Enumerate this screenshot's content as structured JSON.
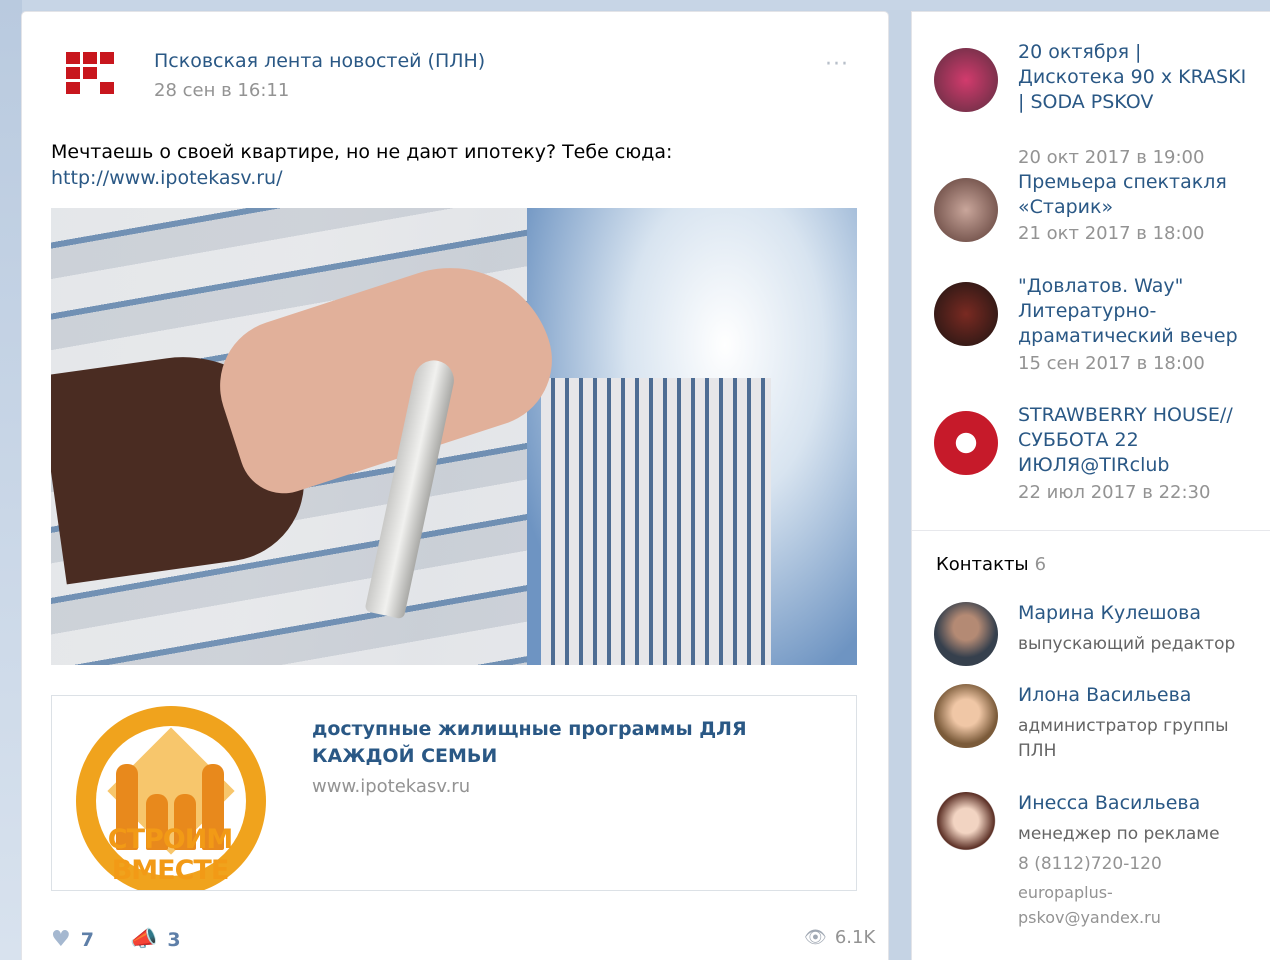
{
  "post": {
    "author": "Псковская лента новостей (ПЛН)",
    "date": "28 сен в 16:11",
    "menu": "···",
    "text": "Мечтаешь о своей квартире, но не дают ипотеку? Тебе сюда:",
    "link": "http://www.ipotekasv.ru/",
    "snippet": {
      "logo_text": "СТРОИМ ВМЕСТЕ",
      "title": "доступные жилищные программы ДЛЯ КАЖДОЙ СЕМЬИ",
      "domain": "www.ipotekasv.ru"
    },
    "likes": "7",
    "shares": "3",
    "views": "6.1K"
  },
  "sidebar": {
    "events": [
      {
        "title": "20 октября | Дискотека 90 х KRASKI | SODA PSKOV",
        "date": "20 окт 2017 в 19:00"
      },
      {
        "title": "Премьера спектакля «Старик»",
        "date": "21 окт 2017 в 18:00"
      },
      {
        "title": "\"Довлатов. Way\" Литературно-драматический вечер",
        "date": "15 сен 2017 в 18:00"
      },
      {
        "title": "STRAWBERRY HOUSE//СУББОТА 22 ИЮЛЯ@TIRclub",
        "date": "22 июл 2017 в 22:30"
      }
    ],
    "contacts_label": "Контакты",
    "contacts_count": "6",
    "contacts": [
      {
        "name": "Марина Кулешова",
        "role": "выпускающий редактор"
      },
      {
        "name": "Илона Васильева",
        "role": "администратор группы ПЛН"
      },
      {
        "name": "Инесса Васильева",
        "role": "менеджер по рекламе",
        "phone": "8 (8112)720-120",
        "email": "europaplus-pskov@yandex.ru"
      }
    ]
  },
  "colors": {
    "link": "#2a5885",
    "muted": "#939393",
    "brand_red": "#c8161d",
    "logo_orange": "#f29a16"
  }
}
